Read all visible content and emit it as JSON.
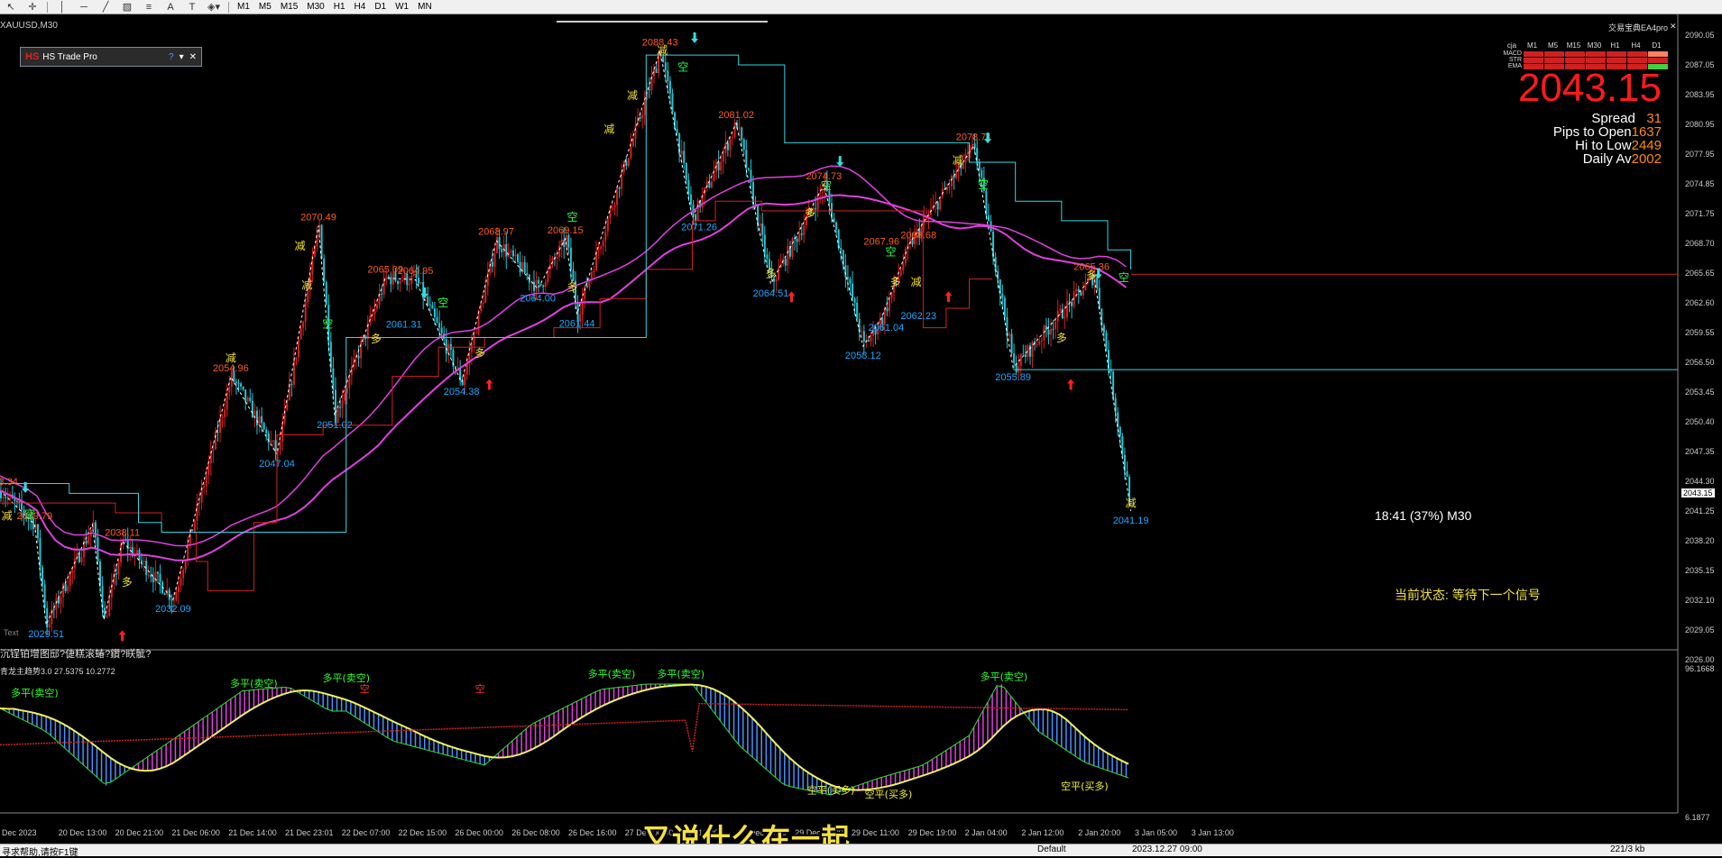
{
  "toolbar": {
    "timeframes": [
      "M1",
      "M5",
      "M15",
      "M30",
      "H1",
      "H4",
      "D1",
      "W1",
      "MN"
    ]
  },
  "chart": {
    "symbol_label": "XAUUSD,M30",
    "indicator_title": "交易宝典EA4pro",
    "close_glyph": "✕",
    "panel": {
      "logo": "HS",
      "title": "HS Trade Pro",
      "help": "?",
      "menu": "▾",
      "close": "✕"
    },
    "indicator_table": {
      "header": [
        "cja",
        "M1",
        "M5",
        "M15",
        "M30",
        "H1",
        "H4",
        "D1"
      ],
      "rows": [
        {
          "name": "MACD",
          "colors": [
            "#d02020",
            "#d02020",
            "#d02020",
            "#d02020",
            "#d02020",
            "#d02020",
            "#ff8060"
          ]
        },
        {
          "name": "STR",
          "colors": [
            "#d02020",
            "#d02020",
            "#d02020",
            "#d02020",
            "#d02020",
            "#d02020",
            "#d02020"
          ]
        },
        {
          "name": "EMA",
          "colors": [
            "#d02020",
            "#d02020",
            "#d02020",
            "#d02020",
            "#d02020",
            "#d02020",
            "#40d040"
          ]
        }
      ]
    },
    "price": "2043.15",
    "info": [
      {
        "label": "Spread",
        "value": "31"
      },
      {
        "label": "Pips to Open",
        "value": "1637"
      },
      {
        "label": "Hi to Low",
        "value": "2449"
      },
      {
        "label": "Daily Av",
        "value": "2002"
      }
    ],
    "status_text": "当前状态: 等待下一个信号",
    "timer_text": "18:41 (37%) M30",
    "text_label": "Text",
    "garbled_text": "沉锃铂增图邸?倢糕滚蝽?鑽?眹骴?",
    "oscillator_name": "青龙主趋势3.0 27.5375 10.2772",
    "price_axis": [
      "2090.05",
      "2087.05",
      "2083.95",
      "2080.95",
      "2077.95",
      "2074.85",
      "2071.75",
      "2068.70",
      "2065.65",
      "2062.60",
      "2059.55",
      "2056.50",
      "2053.45",
      "2050.40",
      "2047.35",
      "2044.30",
      "2041.25",
      "2038.20",
      "2035.15",
      "2032.10",
      "2029.05",
      "2026.00"
    ],
    "osc_axis": [
      "96.1668",
      "6.1877"
    ],
    "time_axis": [
      "Dec 2023",
      "20 Dec 13:00",
      "20 Dec 21:00",
      "21 Dec 06:00",
      "21 Dec 14:00",
      "21 Dec 23:01",
      "22 Dec 07:00",
      "22 Dec 15:00",
      "26 Dec 00:00",
      "26 Dec 08:00",
      "26 Dec 16:00",
      "27 Dec 00:00",
      "Dec 10:00",
      "28 Dec 18:00",
      "29 Dec 03:00",
      "29 Dec 11:00",
      "29 Dec 19:00",
      "2 Jan 04:00",
      "2 Jan 12:00",
      "2 Jan 20:00",
      "3 Jan 05:00",
      "3 Jan 13:00"
    ],
    "price_labels": [
      {
        "t": "2043.34",
        "c": "#ff5a1a"
      },
      {
        "t": "2039.79",
        "c": "#ff5a1a"
      },
      {
        "t": "2038.11",
        "c": "#ff5a1a"
      },
      {
        "t": "2029.51",
        "c": "#1aa8ff"
      },
      {
        "t": "2032.09",
        "c": "#1aa8ff"
      },
      {
        "t": "2054.96",
        "c": "#ff5a1a"
      },
      {
        "t": "2047.04",
        "c": "#1aa8ff"
      },
      {
        "t": "2070.49",
        "c": "#ff5a1a"
      },
      {
        "t": "2051.02",
        "c": "#1aa8ff"
      },
      {
        "t": "2065.09",
        "c": "#ff5a1a"
      },
      {
        "t": "2064.95",
        "c": "#ff5a1a"
      },
      {
        "t": "2061.31",
        "c": "#1aa8ff"
      },
      {
        "t": "2054.38",
        "c": "#1aa8ff"
      },
      {
        "t": "2068.97",
        "c": "#ff5a1a"
      },
      {
        "t": "2064.00",
        "c": "#1aa8ff"
      },
      {
        "t": "2069.15",
        "c": "#ff5a1a"
      },
      {
        "t": "2061.44",
        "c": "#1aa8ff"
      },
      {
        "t": "2088.43",
        "c": "#ff5a1a"
      },
      {
        "t": "2081.02",
        "c": "#ff5a1a"
      },
      {
        "t": "2071.26",
        "c": "#1aa8ff"
      },
      {
        "t": "2064.51",
        "c": "#1aa8ff"
      },
      {
        "t": "2074.73",
        "c": "#ff5a1a"
      },
      {
        "t": "2067.96",
        "c": "#ff5a1a"
      },
      {
        "t": "2068.68",
        "c": "#ff5a1a"
      },
      {
        "t": "2058.12",
        "c": "#1aa8ff"
      },
      {
        "t": "2061.04",
        "c": "#1aa8ff"
      },
      {
        "t": "2062.23",
        "c": "#1aa8ff"
      },
      {
        "t": "2078.71",
        "c": "#ff5a1a"
      },
      {
        "t": "2055.89",
        "c": "#1aa8ff"
      },
      {
        "t": "2065.36",
        "c": "#ff5a1a"
      },
      {
        "t": "2041.19",
        "c": "#1aa8ff"
      }
    ],
    "signal_labels": [
      "减",
      "空",
      "多",
      "减",
      "减",
      "空",
      "多",
      "减",
      "空",
      "多",
      "空",
      "多",
      "减",
      "减",
      "空",
      "减",
      "多",
      "空",
      "多",
      "减",
      "空",
      "多",
      "多",
      "减",
      "空",
      "多",
      "空",
      "减"
    ],
    "osc_labels": [
      "多平(卖空)",
      "多平(卖空)",
      "多平(卖空)",
      "多平(卖空)",
      "多平(卖空)",
      "多平(卖空)",
      "空平(买多)",
      "空平(买多)",
      "空平(买多)",
      "空",
      "空"
    ]
  },
  "subtitle": "又说什么在一起",
  "status_bar": [
    "寻求帮助,请按F1键",
    "Default",
    "2023.12.27 09:00",
    "221/3 kb"
  ]
}
